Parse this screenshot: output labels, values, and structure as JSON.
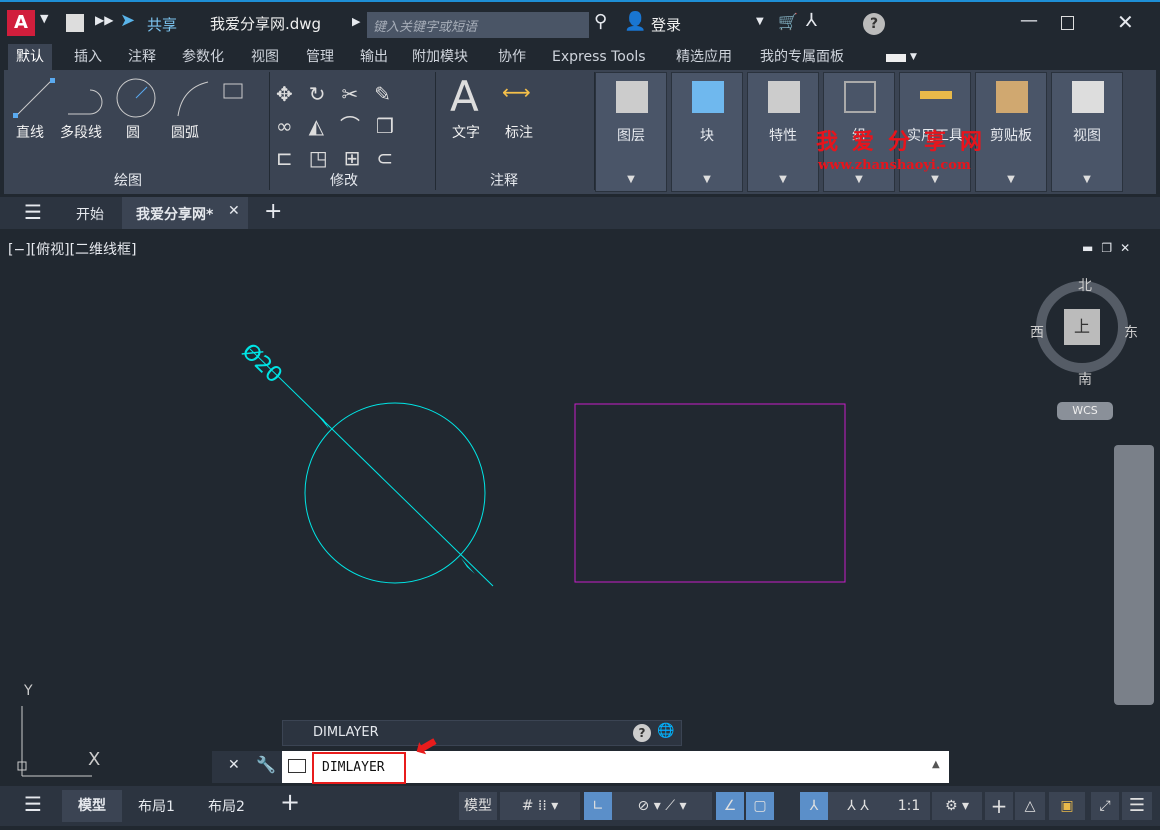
{
  "title": {
    "filename": "我爱分享网.dwg",
    "share": "共享",
    "search_placeholder": "键入关键字或短语",
    "login": "登录",
    "app_logo": "A"
  },
  "ribbon_tabs": [
    "默认",
    "插入",
    "注释",
    "参数化",
    "视图",
    "管理",
    "输出",
    "附加模块",
    "协作",
    "Express Tools",
    "精选应用",
    "我的专属面板"
  ],
  "draw": {
    "line": "直线",
    "polyline": "多段线",
    "circle": "圆",
    "arc": "圆弧",
    "group": "绘图"
  },
  "modify": {
    "group": "修改"
  },
  "annotation": {
    "text": "文字",
    "dimension": "标注",
    "group": "注释"
  },
  "panels": [
    "图层",
    "块",
    "特性",
    "组",
    "实用工具",
    "剪贴板",
    "视图"
  ],
  "watermark": {
    "title": "我爱分享网",
    "url": "www.zhanshaoyi.com"
  },
  "file_tabs": {
    "start": "开始",
    "current": "我爱分享网*"
  },
  "viewport": {
    "label": "[−][俯视][二维线框]"
  },
  "viewcube": {
    "north": "北",
    "south": "南",
    "east": "东",
    "west": "西",
    "top": "上",
    "wcs": "WCS"
  },
  "drawing": {
    "dimension_text": "Ø20",
    "ucs_x": "X",
    "ucs_y": "Y"
  },
  "command": {
    "history": "DIMLAYER",
    "input": "DIMLAYER"
  },
  "status": {
    "model_tab": "模型",
    "layout1": "布局1",
    "layout2": "布局2",
    "model_btn": "模型",
    "scale": "1:1"
  },
  "colors": {
    "accent": "#1e8fd6",
    "circle": "#00e5e5",
    "rect": "#c81ec8",
    "highlight": "#e81c1c"
  }
}
